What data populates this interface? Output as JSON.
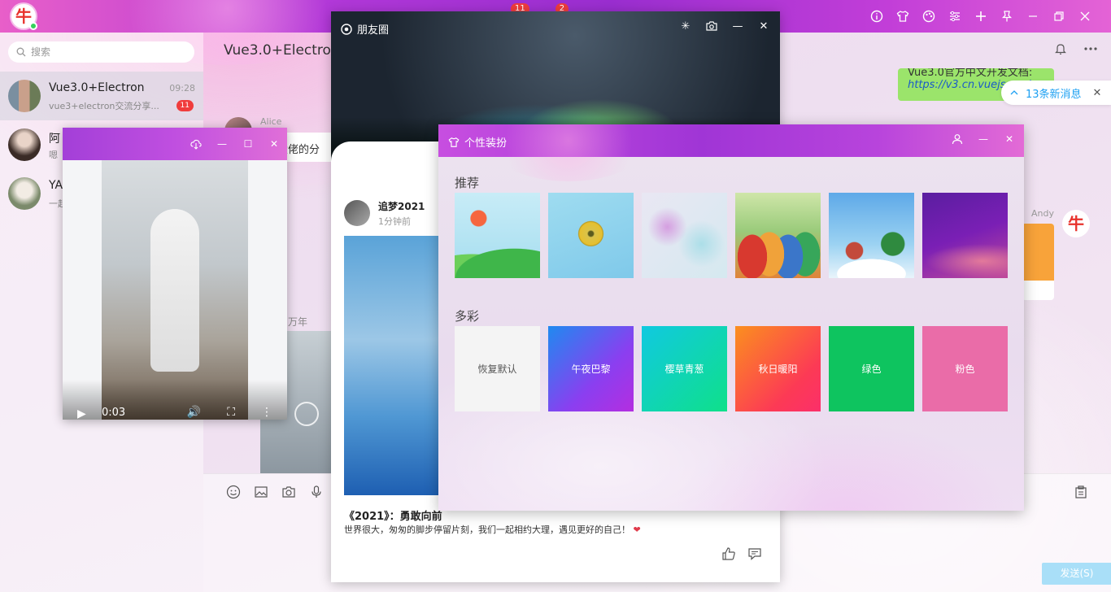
{
  "titlebar": {
    "logo_char": "牛",
    "badges": [
      "11",
      "2"
    ],
    "icons": [
      "info-icon",
      "shirt-icon",
      "palette-icon",
      "sliders-icon",
      "plus-icon",
      "pin-icon",
      "minimize-icon",
      "maximize-icon",
      "close-icon"
    ]
  },
  "sidebar": {
    "search_placeholder": "搜索",
    "chats": [
      {
        "name": "Vue3.0+Electron",
        "time": "09:28",
        "preview": "vue3+electron交流分享...",
        "count": "11"
      },
      {
        "name": "阿",
        "time": "",
        "preview": "嗯",
        "count": ""
      },
      {
        "name": "YA",
        "time": "",
        "preview": "一起",
        "count": ""
      }
    ]
  },
  "chat": {
    "title": "Vue3.0+Electron",
    "green_msg_line1": "Vue3.0官方中文开发文档:",
    "green_msg_link": "https://v3.cn.vuejs.org/",
    "new_messages": "13条新消息",
    "alice_name": "Alice",
    "alice_msg": "谢大佬的分",
    "andy_name": "Andy",
    "andy_avatar": "牛",
    "wan_label": "万年",
    "send_label": "发送(S)"
  },
  "moments": {
    "title": "朋友圈",
    "poster_name": "追梦2021",
    "poster_time": "1分钟前",
    "post_title": "《2021》：勇敢向前",
    "post_text": "世界很大，匆匆的脚步停留片刻，我们一起相约大理，遇见更好的自己！"
  },
  "video": {
    "time": "0:03",
    "progress": 0.3
  },
  "theme": {
    "title": "个性装扮",
    "recommend_label": "推荐",
    "colorful_label": "多彩",
    "solids": [
      {
        "label": "恢复默认",
        "color": "#f4f4f4"
      },
      {
        "label": "午夜巴黎",
        "color": "#6a4cf0"
      },
      {
        "label": "樱草青葱",
        "color": "#10d3b4"
      },
      {
        "label": "秋日暖阳",
        "color": "#fb5a4a"
      },
      {
        "label": "绿色",
        "color": "#0ec45f"
      },
      {
        "label": "粉色",
        "color": "#ea6ca8"
      }
    ]
  }
}
